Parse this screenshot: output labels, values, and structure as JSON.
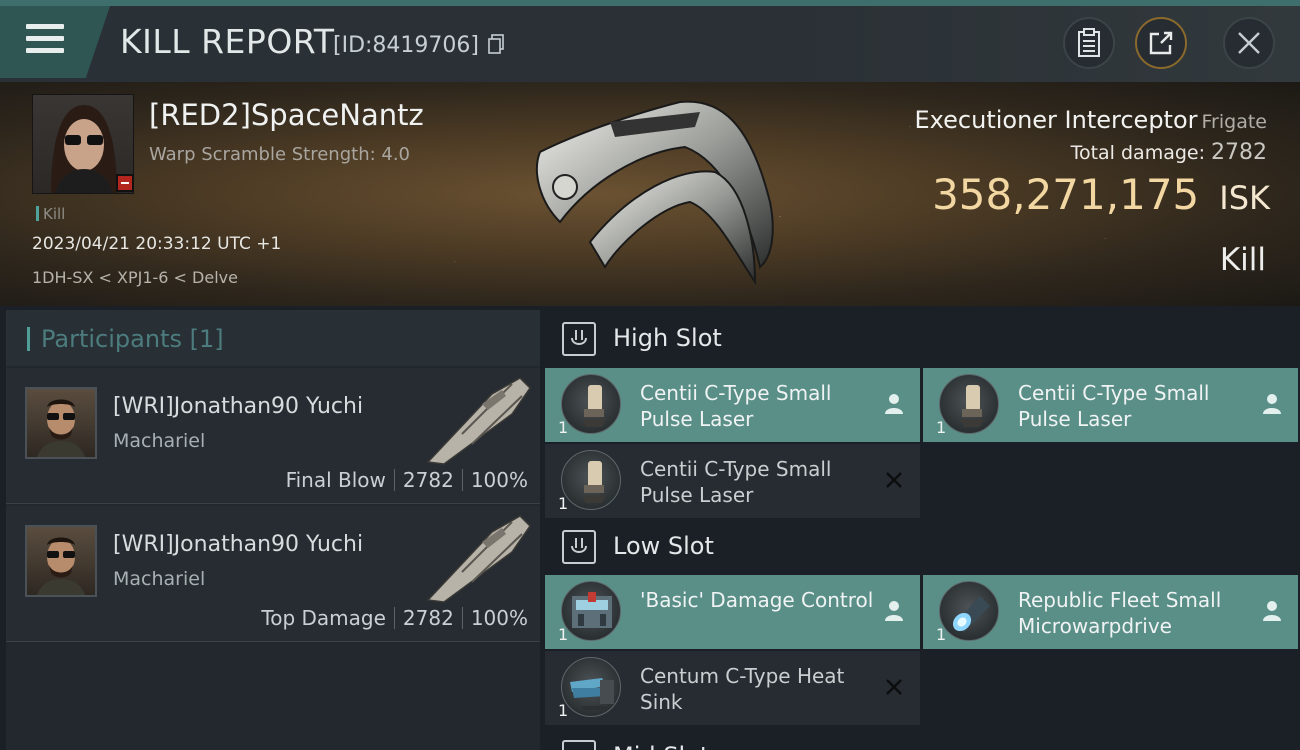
{
  "header": {
    "title": "KILL REPORT",
    "id_text": "[ID:8419706]",
    "icons": [
      "menu-icon",
      "copy-icon",
      "clipboard-icon",
      "share-icon",
      "close-icon"
    ]
  },
  "victim": {
    "name": "[RED2]SpaceNantz",
    "subtitle": "Warp Scramble Strength: 4.0",
    "kill_tag": "Kill",
    "datetime": "2023/04/21 20:33:12 UTC +1",
    "location": "1DH-SX < XPJ1-6 < Delve",
    "ship_name": "Executioner Interceptor",
    "ship_class": "Frigate",
    "total_damage_label": "Total damage:",
    "total_damage": "2782",
    "isk_value": "358,271,175",
    "isk_unit": "ISK",
    "result": "Kill"
  },
  "participants": {
    "label": "Participants [1]",
    "rows": [
      {
        "name": "[WRI]Jonathan90 Yuchi",
        "ship": "Machariel",
        "role": "Final Blow",
        "damage": "2782",
        "percent": "100%"
      },
      {
        "name": "[WRI]Jonathan90 Yuchi",
        "ship": "Machariel",
        "role": "Top Damage",
        "damage": "2782",
        "percent": "100%"
      }
    ]
  },
  "fitting": {
    "high_slot_label": "High Slot",
    "low_slot_label": "Low Slot",
    "next_slot_label": "Mid Slot",
    "high": [
      {
        "name": "Centii C-Type Small Pulse Laser",
        "qty": "1",
        "status": "dropped"
      },
      {
        "name": "Centii C-Type Small Pulse Laser",
        "qty": "1",
        "status": "dropped"
      },
      {
        "name": "Centii C-Type Small Pulse Laser",
        "qty": "1",
        "status": "destroyed"
      }
    ],
    "low": [
      {
        "name": "'Basic' Damage Control",
        "qty": "1",
        "status": "dropped"
      },
      {
        "name": "Republic Fleet Small Microwarpdrive",
        "qty": "1",
        "status": "dropped"
      },
      {
        "name": "Centum C-Type Heat Sink",
        "qty": "1",
        "status": "destroyed"
      }
    ]
  },
  "colors": {
    "accent_teal": "#5a8f88",
    "isk_gold": "#f3d7a2",
    "loss_red": "#b3261e"
  }
}
